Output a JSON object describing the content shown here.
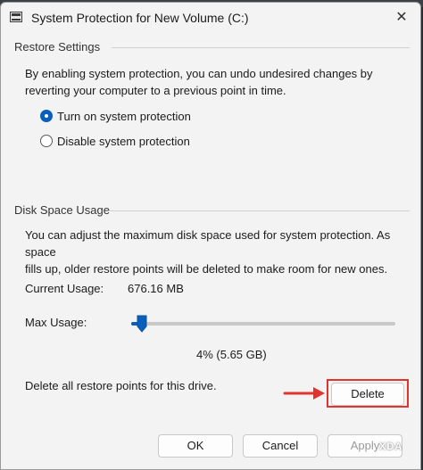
{
  "window": {
    "title": "System Protection for New Volume (C:)",
    "close_glyph": "✕"
  },
  "restore_settings": {
    "group_label": "Restore Settings",
    "description_line1": "By enabling system protection, you can undo undesired changes by",
    "description_line2": "reverting your computer to a previous point in time.",
    "options": [
      {
        "label": "Turn on system protection",
        "checked": true
      },
      {
        "label": "Disable system protection",
        "checked": false
      }
    ]
  },
  "disk_space": {
    "group_label": "Disk Space Usage",
    "description_line1": "You can adjust the maximum disk space used for system protection. As space",
    "description_line2": "fills up, older restore points will be deleted to make room for new ones.",
    "current_usage_label": "Current Usage:",
    "current_usage_value": "676.16 MB",
    "max_usage_label": "Max Usage:",
    "max_usage_fraction": 0.04,
    "max_usage_readout": "4% (5.65 GB)",
    "delete_text": "Delete all restore points for this drive.",
    "delete_button": "Delete"
  },
  "footer": {
    "ok": "OK",
    "cancel": "Cancel",
    "apply": "Apply"
  },
  "annotation": {
    "arrow_color": "#e0342f",
    "box_color": "#e0342f"
  },
  "watermark": "XDA",
  "colors": {
    "accent": "#0a5fbd",
    "dialog_bg": "#f3f3f3"
  }
}
